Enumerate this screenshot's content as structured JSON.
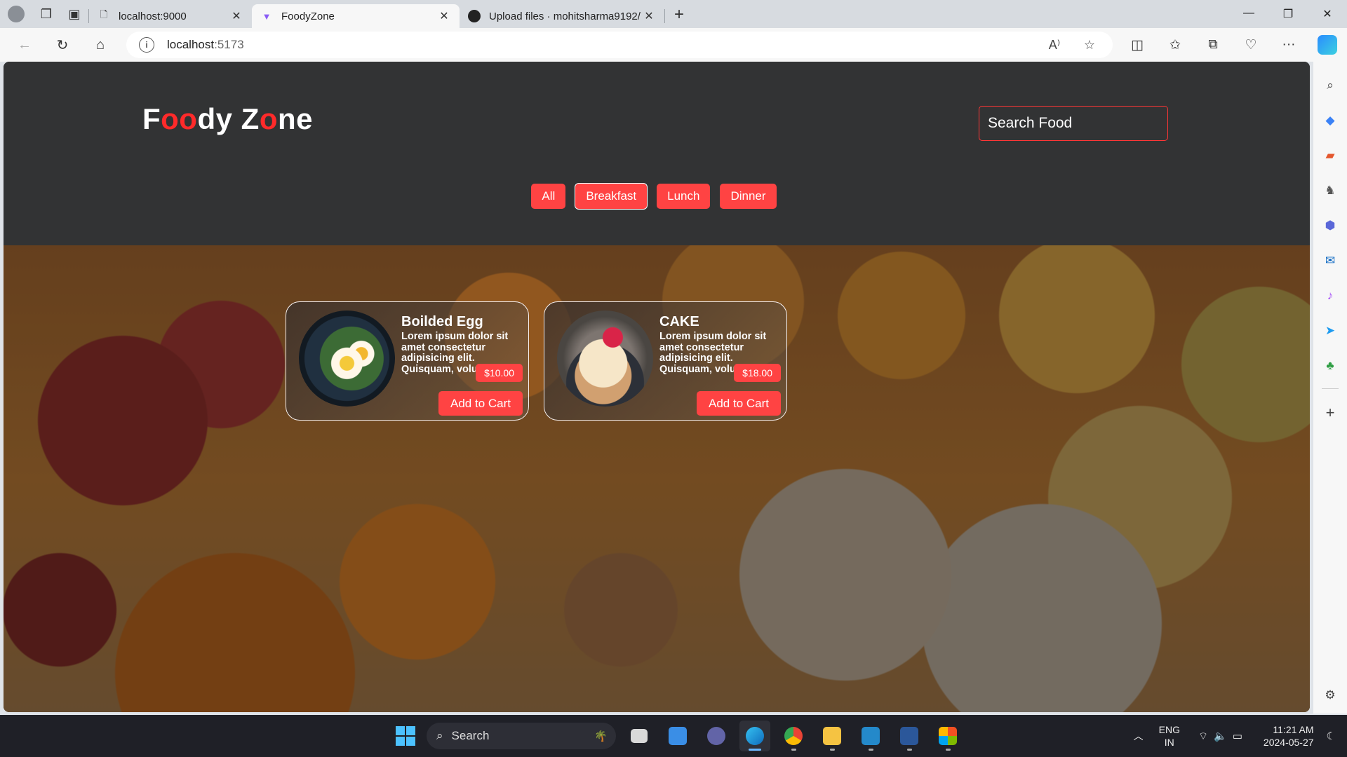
{
  "browser": {
    "tabs": [
      {
        "title": "localhost:9000",
        "active": false
      },
      {
        "title": "FoodyZone",
        "active": true
      },
      {
        "title": "Upload files · mohitsharma9192/",
        "active": false
      }
    ],
    "url_host": "localhost",
    "url_port": ":5173"
  },
  "page": {
    "logo_parts": [
      "F",
      "oo",
      "dy Z",
      "o",
      "ne"
    ],
    "search_placeholder": "Search Food",
    "filters": [
      "All",
      "Breakfast",
      "Lunch",
      "Dinner"
    ],
    "selected_filter": "Breakfast",
    "cards": [
      {
        "name": "Boilded Egg",
        "description": "Lorem ipsum dolor sit amet consectetur adipisicing elit. Quisquam, voluptatum.",
        "price": "$10.00",
        "button": "Add to Cart"
      },
      {
        "name": "CAKE",
        "description": "Lorem ipsum dolor sit amet consectetur adipisicing elit. Quisquam, voluptatum.",
        "price": "$18.00",
        "button": "Add to Cart"
      }
    ]
  },
  "taskbar": {
    "search_label": "Search",
    "lang_line1": "ENG",
    "lang_line2": "IN",
    "time": "11:21 AM",
    "date": "2024-05-27"
  },
  "colors": {
    "accent": "#ff4343",
    "header_bg": "#323334"
  }
}
